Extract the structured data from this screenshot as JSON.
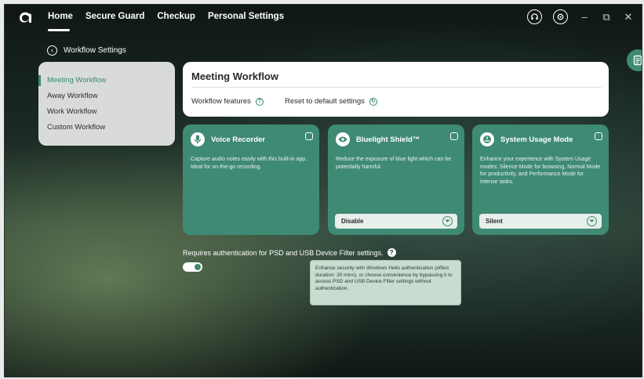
{
  "nav": {
    "tabs": [
      {
        "label": "Home",
        "active": true
      },
      {
        "label": "Secure Guard",
        "active": false
      },
      {
        "label": "Checkup",
        "active": false
      },
      {
        "label": "Personal Settings",
        "active": false
      }
    ],
    "icons": [
      "headset-icon",
      "settings-icon",
      "minimize-icon",
      "restore-icon",
      "close-icon"
    ]
  },
  "back": {
    "label": "Workflow Settings"
  },
  "sidebar": {
    "items": [
      {
        "label": "Meeting Workflow",
        "active": true
      },
      {
        "label": "Away Workflow",
        "active": false
      },
      {
        "label": "Work Workflow",
        "active": false
      },
      {
        "label": "Custom Workflow",
        "active": false
      }
    ]
  },
  "header": {
    "title": "Meeting Workflow",
    "features_label": "Workflow features",
    "reset_label": "Reset to default settings"
  },
  "cards": [
    {
      "name": "Voice Recorder",
      "icon": "microphone-icon",
      "checked": true,
      "description": "Capture audio notes easily with this built-in app. Ideal for on-the-go recording."
    },
    {
      "name": "Bluelight Shield™",
      "icon": "eye-icon",
      "checked": true,
      "description": "Reduce the exposure of blue light which can be potentially harmful.",
      "select_value": "Disable"
    },
    {
      "name": "System Usage Mode",
      "icon": "gauge-icon",
      "checked": true,
      "description": "Enhance your experience with System Usage modes: Silence Mode for browsing, Normal Mode for productivity, and Performance Mode for intense tasks.",
      "select_value": "Silent"
    }
  ],
  "auth": {
    "label": "Requires authentication for PSD and USB Device Filter settings.",
    "enabled": true,
    "tooltip": "Enhance security with Windows Hello authentication (effect duration: 30 mins), or choose convenience by bypassing it to access PSD and USB Device Filter settings without authentication."
  },
  "colors": {
    "accent": "#3f8a74",
    "panel": "#d9dbda",
    "tooltip_bg": "#c9dccf"
  }
}
